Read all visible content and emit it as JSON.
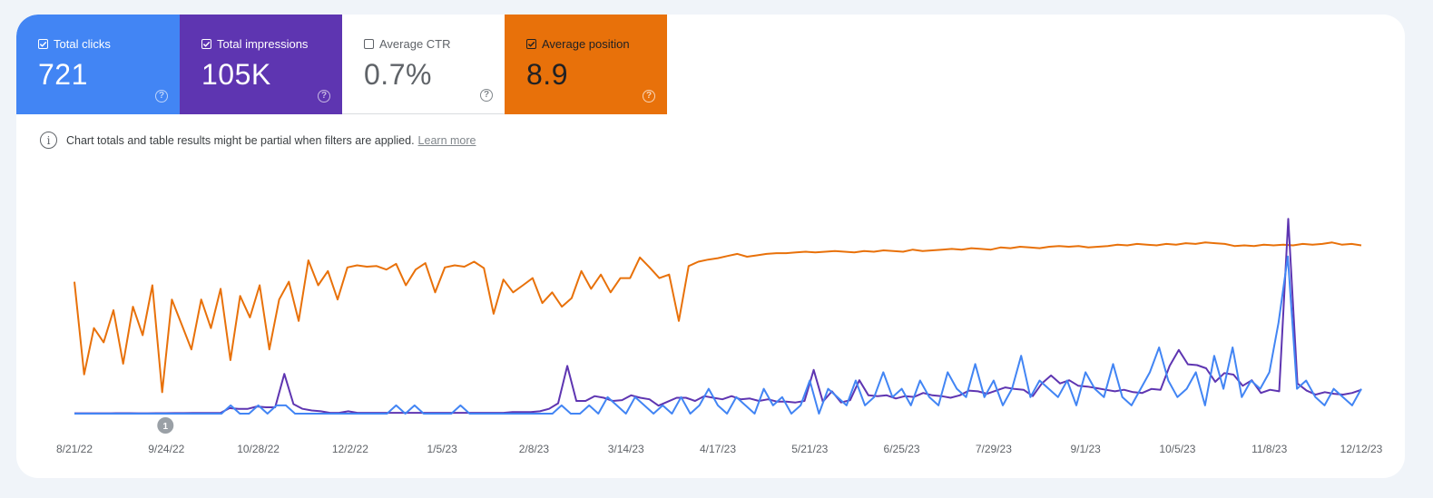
{
  "metrics": [
    {
      "key": "clicks",
      "label": "Total clicks",
      "value": "721",
      "checked": true,
      "color": "#4285f4"
    },
    {
      "key": "impressions",
      "label": "Total impressions",
      "value": "105K",
      "checked": true,
      "color": "#5e35b1"
    },
    {
      "key": "ctr",
      "label": "Average CTR",
      "value": "0.7%",
      "checked": false,
      "color": "#ffffff"
    },
    {
      "key": "position",
      "label": "Average position",
      "value": "8.9",
      "checked": true,
      "color": "#e8710a"
    }
  ],
  "notice": {
    "text": "Chart totals and table results might be partial when filters are applied.",
    "link": "Learn more"
  },
  "annotation": {
    "label": "1",
    "date": "9/24/22"
  },
  "chart_data": {
    "type": "line",
    "title": "",
    "xlabel": "",
    "ylabel": "",
    "x_ticks": [
      "8/21/22",
      "9/24/22",
      "10/28/22",
      "12/2/22",
      "1/5/23",
      "2/8/23",
      "3/14/23",
      "4/17/23",
      "5/21/23",
      "6/25/23",
      "7/29/23",
      "9/1/23",
      "10/5/23",
      "11/8/23",
      "12/12/23"
    ],
    "x_range": [
      "8/21/22",
      "12/17/23"
    ],
    "grid": false,
    "legend": "metric cards above chart",
    "note": "Each series uses its own independent hidden y-axis; values are approximate, sampled ~every 4 days; position axis is inverted (lower is better, drawn higher).",
    "series": [
      {
        "name": "Average position",
        "color": "#e8710a",
        "y_inverted": true,
        "ylim": [
          1,
          30
        ],
        "values": [
          11.5,
          24.5,
          18,
          20,
          15.5,
          23,
          15,
          19,
          12,
          27,
          14,
          17.5,
          21,
          14,
          18,
          12.5,
          22.5,
          13.5,
          16.5,
          12,
          21,
          14,
          11.5,
          17,
          8.5,
          12,
          10,
          14,
          9.5,
          9.2,
          9.4,
          9.3,
          9.8,
          9,
          12,
          9.8,
          8.9,
          13,
          9.5,
          9.2,
          9.4,
          8.7,
          9.6,
          16,
          11.2,
          13,
          12,
          11,
          14.5,
          13,
          15,
          13.8,
          10,
          12.5,
          10.5,
          13,
          11,
          11,
          8.1,
          9.5,
          11,
          10.5,
          17,
          9.3,
          8.7,
          8.4,
          8.2,
          7.9,
          7.6,
          8.0,
          7.8,
          7.6,
          7.5,
          7.5,
          7.4,
          7.3,
          7.4,
          7.3,
          7.2,
          7.3,
          7.4,
          7.2,
          7.3,
          7.1,
          7.2,
          7.3,
          7.0,
          7.2,
          7.1,
          7.0,
          6.9,
          7.0,
          6.8,
          6.9,
          7.0,
          6.7,
          6.8,
          6.6,
          6.7,
          6.8,
          6.6,
          6.5,
          6.6,
          6.5,
          6.7,
          6.6,
          6.5,
          6.3,
          6.4,
          6.2,
          6.3,
          6.4,
          6.2,
          6.3,
          6.1,
          6.2,
          6.0,
          6.1,
          6.2,
          6.5,
          6.4,
          6.5,
          6.3,
          6.4,
          6.3,
          6.4,
          6.2,
          6.3,
          6.2,
          6.0,
          6.3,
          6.2,
          6.4
        ]
      },
      {
        "name": "Total impressions",
        "color": "#5e35b1",
        "ylim": [
          0,
          2600
        ],
        "values": [
          5,
          5,
          5,
          5,
          5,
          6,
          6,
          5,
          5,
          6,
          6,
          7,
          7,
          8,
          8,
          8,
          8,
          70,
          60,
          60,
          90,
          80,
          80,
          500,
          120,
          60,
          40,
          30,
          10,
          10,
          30,
          10,
          10,
          10,
          10,
          10,
          10,
          10,
          10,
          10,
          10,
          10,
          10,
          10,
          10,
          10,
          10,
          10,
          20,
          20,
          20,
          30,
          60,
          130,
          600,
          160,
          160,
          220,
          200,
          160,
          170,
          230,
          200,
          180,
          100,
          150,
          200,
          200,
          160,
          220,
          200,
          180,
          220,
          180,
          190,
          160,
          180,
          150,
          150,
          140,
          160,
          550,
          150,
          280,
          140,
          170,
          420,
          230,
          220,
          230,
          190,
          220,
          210,
          260,
          230,
          220,
          200,
          230,
          290,
          280,
          250,
          290,
          330,
          310,
          300,
          220,
          380,
          480,
          380,
          420,
          350,
          340,
          320,
          300,
          280,
          300,
          270,
          260,
          310,
          300,
          600,
          800,
          620,
          610,
          570,
          400,
          510,
          490,
          350,
          420,
          260,
          300,
          280,
          2450,
          380,
          290,
          240,
          270,
          250,
          240,
          260,
          300
        ]
      },
      {
        "name": "Total clicks",
        "color": "#4285f4",
        "ylim": [
          0,
          25
        ],
        "values": [
          0,
          0,
          0,
          0,
          0,
          0,
          0,
          0,
          0,
          0,
          0,
          0,
          0,
          0,
          0,
          0,
          0,
          1,
          0,
          0,
          1,
          0,
          1,
          1,
          0,
          0,
          0,
          0,
          0,
          0,
          0,
          0,
          0,
          0,
          0,
          1,
          0,
          1,
          0,
          0,
          0,
          0,
          1,
          0,
          0,
          0,
          0,
          0,
          0,
          0,
          0,
          0,
          0,
          1,
          0,
          0,
          1,
          0,
          2,
          1,
          0,
          2,
          1,
          0,
          1,
          0,
          2,
          0,
          1,
          3,
          1,
          0,
          2,
          1,
          0,
          3,
          1,
          2,
          0,
          1,
          4,
          0,
          3,
          2,
          1,
          4,
          1,
          2,
          5,
          2,
          3,
          1,
          4,
          2,
          1,
          5,
          3,
          2,
          6,
          2,
          4,
          1,
          3,
          7,
          2,
          4,
          3,
          2,
          4,
          1,
          5,
          3,
          2,
          6,
          2,
          1,
          3,
          5,
          8,
          4,
          2,
          3,
          5,
          1,
          7,
          3,
          8,
          2,
          4,
          3,
          5,
          11,
          19,
          3,
          4,
          2,
          1,
          3,
          2,
          1,
          3
        ]
      }
    ]
  }
}
